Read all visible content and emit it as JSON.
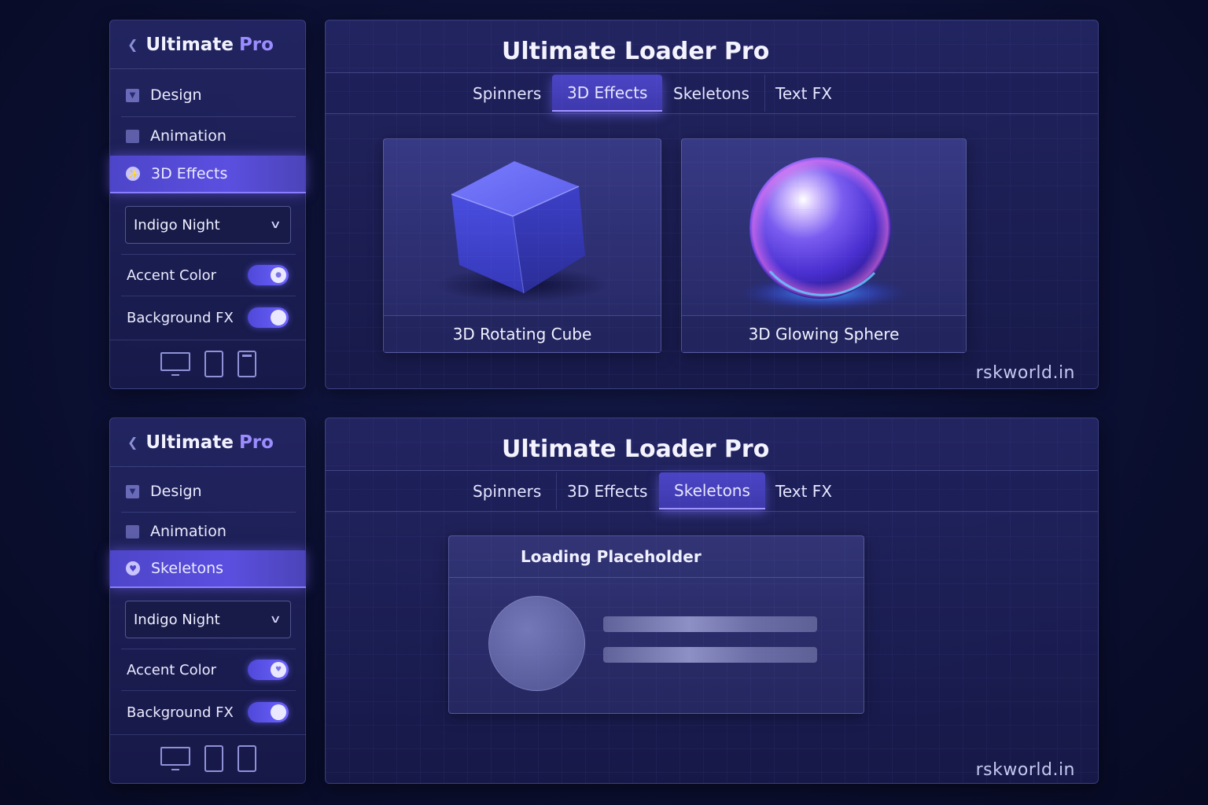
{
  "app": {
    "brand": "Ultimate",
    "brand_accent": "Pro",
    "title": "Ultimate Loader Pro",
    "watermark": "rskworld.in"
  },
  "colors": {
    "accent": "#6c63ff",
    "active_item": "#4d45c9",
    "background": "#0c1033",
    "panel": "#24266a"
  },
  "top": {
    "sidebar": {
      "items": [
        {
          "label": "Design",
          "icon": "checkbox-checked-icon"
        },
        {
          "label": "Animation",
          "icon": "checkbox-icon"
        },
        {
          "label": "3D Effects",
          "icon": "cube-icon",
          "active": true
        }
      ],
      "theme_select": "Indigo Night",
      "toggles": [
        {
          "label": "Accent Color",
          "on": true
        },
        {
          "label": "Background FX",
          "on": true
        }
      ],
      "devices": [
        "desktop-icon",
        "tablet-icon",
        "phone-icon"
      ]
    },
    "tabs": [
      {
        "label": "Spinners"
      },
      {
        "label": "3D Effects",
        "active": true
      },
      {
        "label": "Skeletons"
      },
      {
        "label": "Text FX"
      }
    ],
    "cards": [
      {
        "label": "3D Rotating Cube"
      },
      {
        "label": "3D Glowing Sphere"
      }
    ]
  },
  "bottom": {
    "sidebar": {
      "items": [
        {
          "label": "Design",
          "icon": "checkbox-checked-icon"
        },
        {
          "label": "Animation",
          "icon": "checkbox-icon"
        },
        {
          "label": "Skeletons",
          "icon": "heart-icon",
          "active": true
        }
      ],
      "theme_select": "Indigo Night",
      "toggles": [
        {
          "label": "Accent Color",
          "on": true
        },
        {
          "label": "Background FX",
          "on": true
        }
      ],
      "devices": [
        "desktop-icon",
        "tablet-icon",
        "phone-icon"
      ]
    },
    "tabs": [
      {
        "label": "Spinners"
      },
      {
        "label": "3D Effects"
      },
      {
        "label": "Skeletons",
        "active": true
      },
      {
        "label": "Text FX"
      }
    ],
    "skeleton_card": {
      "title": "Loading Placeholder"
    }
  }
}
